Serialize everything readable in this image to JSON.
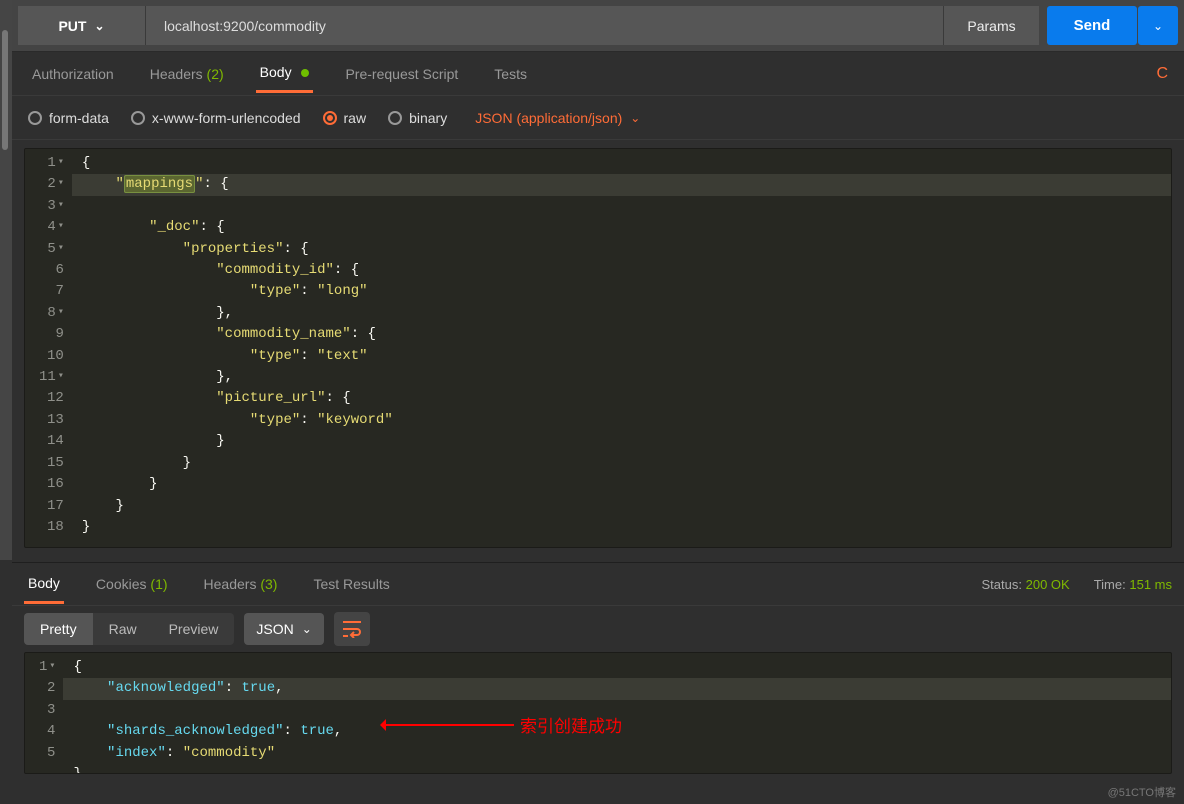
{
  "request": {
    "method": "PUT",
    "url": "localhost:9200/commodity",
    "params_label": "Params",
    "send_label": "Send"
  },
  "req_tabs": {
    "authorization": "Authorization",
    "headers": "Headers",
    "headers_count": "(2)",
    "body": "Body",
    "pre": "Pre-request Script",
    "tests": "Tests"
  },
  "body_type": {
    "form": "form-data",
    "url": "x-www-form-urlencoded",
    "raw": "raw",
    "binary": "binary",
    "content_type": "JSON (application/json)"
  },
  "req_body_lines": [
    "{",
    "    \"mappings\": {",
    "        \"_doc\": {",
    "            \"properties\": {",
    "                \"commodity_id\": {",
    "                    \"type\": \"long\"",
    "                },",
    "                \"commodity_name\": {",
    "                    \"type\": \"text\"",
    "                },",
    "                \"picture_url\": {",
    "                    \"type\": \"keyword\"",
    "                }",
    "            }",
    "        }",
    "    }",
    "}",
    ""
  ],
  "res_tabs": {
    "body": "Body",
    "cookies": "Cookies",
    "cookies_count": "(1)",
    "headers": "Headers",
    "headers_count": "(3)",
    "tests": "Test Results"
  },
  "status": {
    "label": "Status:",
    "value": "200 OK",
    "time_label": "Time:",
    "time_value": "151 ms"
  },
  "res_mode": {
    "pretty": "Pretty",
    "raw": "Raw",
    "preview": "Preview",
    "type": "JSON"
  },
  "res_body": {
    "acknowledged_key": "acknowledged",
    "shards_key": "shards_acknowledged",
    "index_key": "index",
    "true_val": "true",
    "index_val": "commodity"
  },
  "annotation": "索引创建成功",
  "watermark": "@51CTO博客"
}
